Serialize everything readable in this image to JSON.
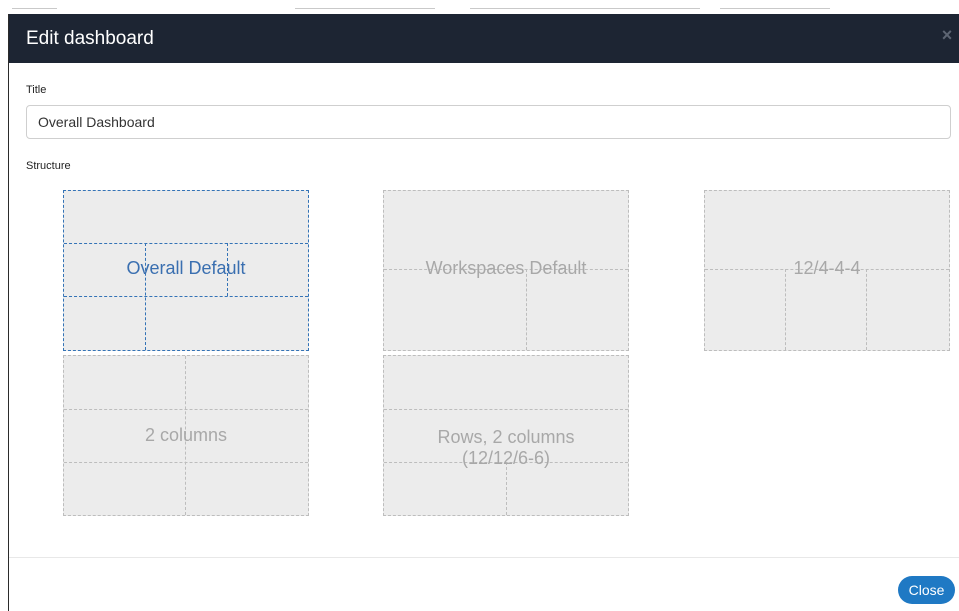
{
  "modal": {
    "title": "Edit dashboard",
    "close_glyph": "×",
    "close_icon": "close-icon"
  },
  "form": {
    "title_label": "Title",
    "title_value": "Overall Dashboard",
    "structure_label": "Structure"
  },
  "structures": [
    {
      "label": "Overall Default",
      "selected": true
    },
    {
      "label": "Workspaces Default",
      "selected": false
    },
    {
      "label": "12/4-4-4",
      "selected": false
    },
    {
      "label": "2 columns",
      "selected": false
    },
    {
      "label": "Rows, 2 columns (12/12/6-6)",
      "selected": false
    }
  ],
  "footer": {
    "close_label": "Close"
  },
  "colors": {
    "header_bg": "#1d2533",
    "accent": "#1f79c4",
    "selected": "#3473b6",
    "tile_bg": "#ececec"
  }
}
